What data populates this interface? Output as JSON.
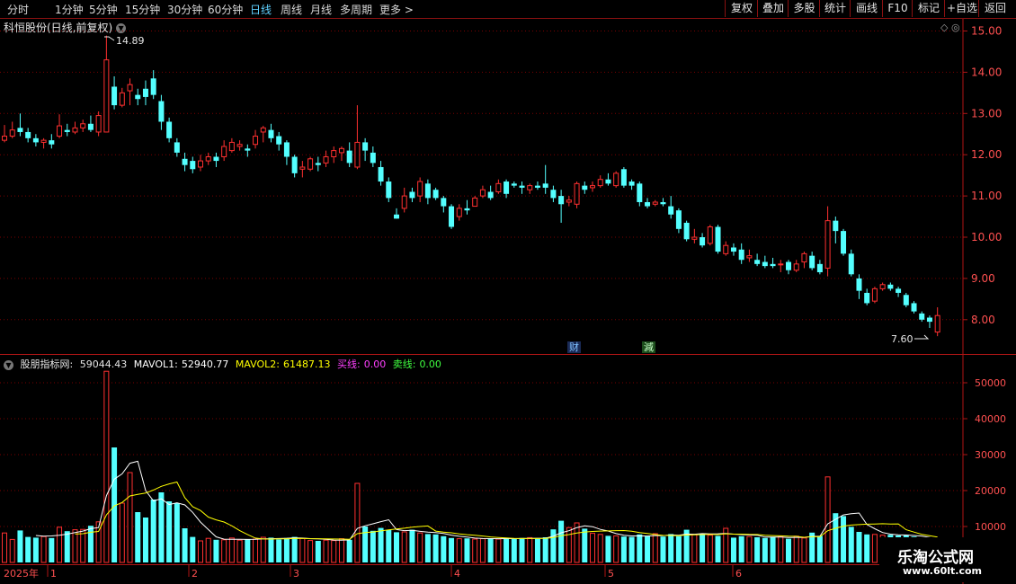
{
  "toolbar": {
    "periods": [
      "分时",
      "1分钟",
      "5分钟",
      "15分钟",
      "30分钟",
      "60分钟",
      "日线",
      "周线",
      "月线",
      "多周期",
      "更多"
    ],
    "active_period": "日线",
    "buttons": [
      "复权",
      "叠加",
      "多股",
      "统计",
      "画线",
      "F10",
      "标记",
      "+自选",
      "返回"
    ]
  },
  "stock_title": "科恒股份(日线,前复权)",
  "price_axis": [
    "15.00",
    "14.00",
    "13.00",
    "12.00",
    "11.00",
    "10.00",
    "9.00",
    "8.00"
  ],
  "markers": {
    "high_label": "14.89",
    "low_label": "7.60",
    "event1": "财",
    "event2": "減"
  },
  "indicator": {
    "name": "股朋指标网",
    "value": "59044.43",
    "mavol1_label": "MAVOL1:",
    "mavol1_value": "52940.77",
    "mavol2_label": "MAVOL2:",
    "mavol2_value": "61487.13",
    "buy_label": "买线:",
    "buy_value": "0.00",
    "sell_label": "卖线:",
    "sell_value": "0.00"
  },
  "volume_axis": [
    "50000",
    "40000",
    "30000",
    "20000",
    "10000"
  ],
  "date_axis": {
    "year": "2025年",
    "months": [
      "1",
      "2",
      "3",
      "4",
      "5",
      "6"
    ]
  },
  "watermark": {
    "title": "乐淘公式网",
    "url": "www.60lt.com"
  },
  "colors": {
    "up": "#ff3030",
    "down": "#54ffff",
    "mavol1": "#ffffff",
    "mavol2": "#ffff00",
    "grid": "#7a0000",
    "buy": "#ff40ff",
    "sell": "#40ff40"
  },
  "chart_data": {
    "type": "candlestick",
    "candles": [
      [
        12.35,
        12.45,
        12.72,
        12.3
      ],
      [
        12.45,
        12.6,
        12.8,
        12.4
      ],
      [
        12.65,
        12.55,
        13.0,
        12.45
      ],
      [
        12.55,
        12.4,
        12.65,
        12.3
      ],
      [
        12.4,
        12.3,
        12.5,
        12.2
      ],
      [
        12.3,
        12.35,
        12.4,
        12.15
      ],
      [
        12.35,
        12.25,
        12.5,
        12.15
      ],
      [
        12.45,
        12.7,
        12.98,
        12.4
      ],
      [
        12.6,
        12.55,
        12.75,
        12.45
      ],
      [
        12.55,
        12.65,
        12.8,
        12.5
      ],
      [
        12.65,
        12.75,
        12.85,
        12.55
      ],
      [
        12.75,
        12.6,
        12.95,
        12.55
      ],
      [
        12.55,
        12.95,
        13.05,
        12.45
      ],
      [
        12.55,
        14.3,
        14.89,
        12.55
      ],
      [
        13.65,
        13.2,
        13.9,
        13.1
      ],
      [
        13.2,
        13.5,
        13.62,
        13.15
      ],
      [
        13.55,
        13.7,
        13.85,
        13.2
      ],
      [
        13.45,
        13.35,
        13.6,
        13.2
      ],
      [
        13.6,
        13.4,
        13.8,
        13.2
      ],
      [
        13.85,
        13.45,
        14.05,
        13.35
      ],
      [
        13.3,
        12.8,
        13.45,
        12.6
      ],
      [
        12.8,
        12.4,
        12.9,
        12.3
      ],
      [
        12.3,
        12.05,
        12.4,
        11.95
      ],
      [
        11.9,
        11.75,
        12.05,
        11.6
      ],
      [
        11.85,
        11.65,
        11.95,
        11.55
      ],
      [
        11.7,
        11.85,
        12.0,
        11.6
      ],
      [
        11.85,
        11.95,
        12.05,
        11.75
      ],
      [
        11.95,
        11.85,
        12.05,
        11.7
      ],
      [
        11.95,
        12.2,
        12.35,
        11.85
      ],
      [
        12.1,
        12.3,
        12.4,
        12.05
      ],
      [
        12.2,
        12.25,
        12.35,
        12.1
      ],
      [
        12.15,
        12.1,
        12.25,
        11.95
      ],
      [
        12.25,
        12.45,
        12.6,
        12.15
      ],
      [
        12.55,
        12.65,
        12.7,
        12.3
      ],
      [
        12.6,
        12.4,
        12.75,
        12.3
      ],
      [
        12.45,
        12.25,
        12.55,
        12.1
      ],
      [
        12.3,
        11.95,
        12.35,
        11.75
      ],
      [
        11.95,
        11.55,
        12.0,
        11.45
      ],
      [
        11.65,
        11.7,
        11.85,
        11.45
      ],
      [
        11.65,
        11.9,
        11.95,
        11.6
      ],
      [
        11.8,
        11.75,
        11.95,
        11.6
      ],
      [
        11.8,
        11.95,
        12.1,
        11.7
      ],
      [
        11.95,
        12.1,
        12.2,
        11.8
      ],
      [
        12.05,
        12.15,
        12.2,
        11.85
      ],
      [
        12.1,
        11.8,
        12.3,
        11.7
      ],
      [
        11.7,
        12.3,
        13.2,
        11.65
      ],
      [
        12.3,
        12.1,
        12.4,
        11.85
      ],
      [
        12.05,
        11.8,
        12.2,
        11.7
      ],
      [
        11.7,
        11.35,
        11.85,
        11.25
      ],
      [
        11.35,
        10.95,
        11.45,
        10.85
      ],
      [
        10.55,
        10.45,
        10.7,
        10.45
      ],
      [
        10.7,
        11.0,
        11.2,
        10.6
      ],
      [
        11.1,
        10.95,
        11.2,
        10.85
      ],
      [
        11.0,
        11.35,
        11.45,
        10.85
      ],
      [
        11.3,
        10.95,
        11.4,
        10.8
      ],
      [
        11.15,
        10.95,
        11.2,
        10.9
      ],
      [
        10.95,
        10.75,
        11.0,
        10.6
      ],
      [
        10.75,
        10.25,
        10.8,
        10.2
      ],
      [
        10.5,
        10.7,
        10.8,
        10.4
      ],
      [
        10.7,
        10.65,
        10.9,
        10.55
      ],
      [
        10.75,
        10.95,
        11.0,
        10.75
      ],
      [
        11.0,
        11.15,
        11.25,
        10.95
      ],
      [
        11.1,
        10.95,
        11.25,
        10.9
      ],
      [
        11.1,
        11.3,
        11.4,
        11.05
      ],
      [
        11.35,
        11.05,
        11.4,
        10.95
      ],
      [
        11.3,
        11.25,
        11.35,
        11.2
      ],
      [
        11.25,
        11.2,
        11.35,
        11.05
      ],
      [
        11.15,
        11.25,
        11.3,
        11.05
      ],
      [
        11.25,
        11.2,
        11.35,
        11.15
      ],
      [
        11.3,
        11.2,
        11.75,
        11.05
      ],
      [
        11.15,
        10.95,
        11.25,
        10.85
      ],
      [
        11.0,
        10.8,
        11.15,
        10.35
      ],
      [
        10.85,
        10.9,
        11.0,
        10.75
      ],
      [
        10.8,
        11.3,
        11.35,
        10.7
      ],
      [
        11.25,
        11.15,
        11.35,
        11.05
      ],
      [
        11.2,
        11.25,
        11.35,
        11.1
      ],
      [
        11.25,
        11.4,
        11.5,
        11.2
      ],
      [
        11.4,
        11.3,
        11.55,
        11.25
      ],
      [
        11.25,
        11.55,
        11.6,
        11.2
      ],
      [
        11.65,
        11.25,
        11.7,
        11.2
      ],
      [
        11.35,
        11.25,
        11.4,
        11.15
      ],
      [
        11.3,
        10.85,
        11.35,
        10.75
      ],
      [
        10.85,
        10.75,
        10.95,
        10.7
      ],
      [
        10.8,
        10.85,
        10.9,
        10.75
      ],
      [
        10.85,
        10.8,
        10.95,
        10.75
      ],
      [
        10.75,
        10.55,
        11.0,
        10.45
      ],
      [
        10.65,
        10.2,
        10.7,
        10.1
      ],
      [
        10.35,
        9.95,
        10.4,
        9.9
      ],
      [
        9.95,
        10.0,
        10.2,
        9.85
      ],
      [
        10.0,
        9.8,
        10.1,
        9.75
      ],
      [
        9.85,
        10.25,
        10.3,
        9.8
      ],
      [
        10.25,
        9.65,
        10.3,
        9.6
      ],
      [
        9.6,
        9.8,
        9.9,
        9.55
      ],
      [
        9.75,
        9.65,
        9.85,
        9.55
      ],
      [
        9.7,
        9.45,
        9.85,
        9.35
      ],
      [
        9.5,
        9.55,
        9.7,
        9.4
      ],
      [
        9.45,
        9.35,
        9.6,
        9.3
      ],
      [
        9.4,
        9.3,
        9.55,
        9.25
      ],
      [
        9.35,
        9.3,
        9.5,
        9.25
      ],
      [
        9.35,
        9.35,
        9.45,
        9.15
      ],
      [
        9.4,
        9.2,
        9.45,
        9.1
      ],
      [
        9.2,
        9.35,
        9.45,
        9.15
      ],
      [
        9.4,
        9.6,
        9.65,
        9.25
      ],
      [
        9.55,
        9.25,
        9.65,
        9.2
      ],
      [
        9.35,
        9.15,
        9.45,
        9.1
      ],
      [
        9.25,
        10.4,
        10.75,
        9.05
      ],
      [
        10.4,
        10.15,
        10.5,
        9.85
      ],
      [
        10.15,
        9.6,
        10.2,
        9.55
      ],
      [
        9.6,
        9.1,
        9.7,
        9.05
      ],
      [
        9.0,
        8.7,
        9.1,
        8.5
      ],
      [
        8.65,
        8.4,
        8.75,
        8.35
      ],
      [
        8.45,
        8.75,
        8.8,
        8.4
      ],
      [
        8.75,
        8.85,
        8.9,
        8.7
      ],
      [
        8.85,
        8.75,
        8.9,
        8.7
      ],
      [
        8.75,
        8.65,
        8.8,
        8.55
      ],
      [
        8.6,
        8.35,
        8.65,
        8.3
      ],
      [
        8.4,
        8.2,
        8.45,
        8.15
      ],
      [
        8.15,
        8.0,
        8.2,
        7.95
      ],
      [
        8.05,
        7.95,
        8.1,
        7.8
      ],
      [
        7.7,
        8.1,
        8.3,
        7.6
      ]
    ],
    "volume": [
      8200,
      6400,
      8900,
      7100,
      6900,
      7200,
      6800,
      9800,
      8700,
      9100,
      9200,
      10200,
      11300,
      53200,
      32000,
      16500,
      25000,
      14000,
      12500,
      17500,
      19500,
      17000,
      16500,
      9500,
      7100,
      6000,
      6700,
      6300,
      6300,
      6800,
      6200,
      6400,
      6500,
      7000,
      6900,
      6400,
      6800,
      7100,
      6700,
      6100,
      6000,
      6200,
      6100,
      6600,
      6300,
      22000,
      10000,
      8800,
      9600,
      9000,
      8400,
      8500,
      9100,
      8200,
      7900,
      7800,
      7300,
      6800,
      6600,
      6700,
      6500,
      6600,
      6700,
      6500,
      6800,
      6500,
      6800,
      6900,
      6600,
      7000,
      9200,
      11600,
      9700,
      11000,
      9400,
      8100,
      7800,
      7400,
      7400,
      7200,
      7100,
      7800,
      7300,
      8000,
      7200,
      7900,
      7300,
      9100,
      7800,
      8000,
      7600,
      7400,
      9500,
      6900,
      7300,
      7200,
      7000,
      6800,
      7000,
      7200,
      6600,
      7300,
      6800,
      8300,
      7400,
      23800,
      13700,
      12900,
      9900,
      8500,
      7800,
      7800,
      7600,
      7700,
      7500,
      7500,
      7200,
      6800,
      5800,
      4800
    ],
    "ylim": [
      7.2,
      15.3
    ],
    "vol_ylim": [
      0,
      55000
    ],
    "x_ticks": [
      "1",
      "2",
      "3",
      "4",
      "5",
      "6"
    ]
  }
}
